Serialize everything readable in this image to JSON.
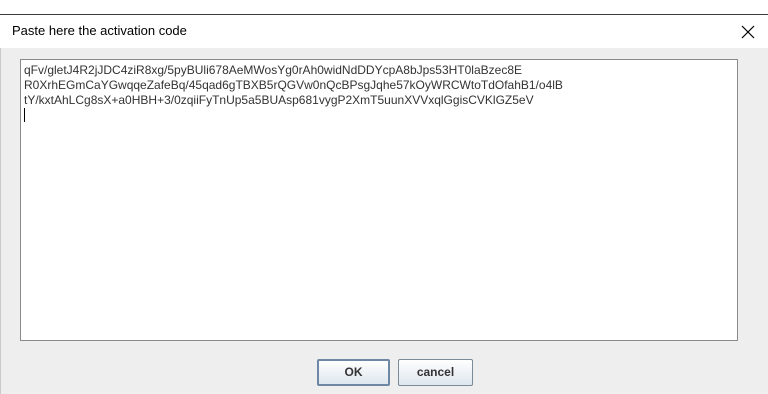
{
  "dialog": {
    "title": "Paste here the activation code",
    "close_icon": "close-icon"
  },
  "textarea": {
    "lines": [
      "qFv/gletJ4R2jJDC4ziR8xg/5pyBUli678AeMWosYg0rAh0widNdDDYcpA8bJps53HT0laBzec8E",
      "R0XrhEGmCaYGwqqeZafeBq/45qad6gTBXB5rQGVw0nQcBPsgJqhe57kOyWRCWtoTdOfahB1/o4lB",
      "tY/kxtAhLCg8sX+a0HBH+3/0zqiiFyTnUp5a5BUAsp681vygP2XmT5uunXVVxqlGgisCVKlGZ5eV"
    ]
  },
  "buttons": {
    "ok_label": "OK",
    "cancel_label": "cancel"
  }
}
